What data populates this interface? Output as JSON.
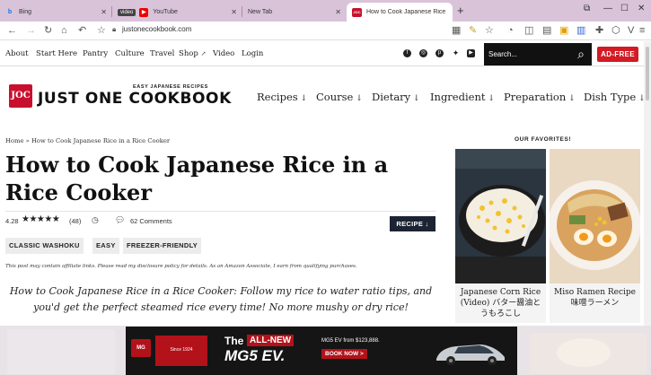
{
  "browser": {
    "tabs": [
      {
        "label": "Bing",
        "favicon": "b"
      },
      {
        "label": "YouTube",
        "badge": "video"
      },
      {
        "label": "New Tab"
      },
      {
        "label": "How to Cook Japanese Rice i",
        "favicon": "JOC"
      }
    ],
    "url": "justonecookbook.com"
  },
  "sitenav": {
    "links": [
      "About",
      "Start Here",
      "Pantry",
      "Culture",
      "Travel",
      "Shop",
      "Video",
      "Login"
    ],
    "search_placeholder": "Search...",
    "adfree_label": "AD-FREE"
  },
  "logo": {
    "mark": "JOC",
    "subtitle": "EASY JAPANESE RECIPES",
    "name": "JUST ONE COOKBOOK"
  },
  "categories": [
    "Recipes",
    "Course",
    "Dietary",
    "Ingredient",
    "Preparation",
    "Dish Type"
  ],
  "article": {
    "breadcrumb": "Home » How to Cook Japanese Rice in a Rice Cooker",
    "title": "How to Cook Japanese Rice in a Rice Cooker",
    "rating": "4.28",
    "rating_stars": 5,
    "rating_count": "(48)",
    "comments": "62 Comments",
    "recipe_button": "RECIPE",
    "tags": [
      "CLASSIC WASHOKU",
      "EASY",
      "FREEZER-FRIENDLY"
    ],
    "disclosure": "This post may contain affiliate links. Please read my disclosure policy for details. As an Amazon Associate, I earn from qualifying purchases.",
    "lead": "How to Cook Japanese Rice in a Rice Cooker: Follow my rice to water ratio tips, and you'd get the perfect steamed rice every time! No more mushy or dry rice!"
  },
  "sidebar": {
    "heading": "OUR FAVORITES!",
    "cards": [
      {
        "caption": "Japanese Corn Rice (Video) バター醤油とうもろこし"
      },
      {
        "caption": "Miso Ramen Recipe 味噌ラーメン"
      }
    ]
  },
  "ad": {
    "logo": "MG",
    "since": "Since 1924",
    "line1": "The",
    "allnew": "ALL-NEW",
    "model": "MG5 EV.",
    "price": "MG5 EV from $123,888.",
    "cta": "BOOK NOW >"
  }
}
